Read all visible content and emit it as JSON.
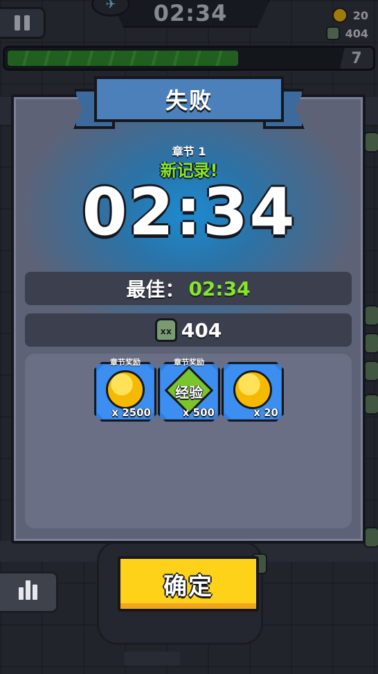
{
  "hud": {
    "timer": "02:34",
    "coins": "20",
    "kills": "404",
    "level": "7",
    "xp_progress": 0.7
  },
  "result": {
    "title": "失败",
    "chapter": "章节 1",
    "new_record": "新记录!",
    "time": "02:34",
    "best_label": "最佳：",
    "best_value": "02:34",
    "kills": "404"
  },
  "rewards": [
    {
      "tag": "章节奖励",
      "type": "coin",
      "qty": "x 2500"
    },
    {
      "tag": "章节奖励",
      "type": "exp",
      "label": "经验",
      "qty": "x 500"
    },
    {
      "tag": "",
      "type": "coin",
      "qty": "x 20"
    }
  ],
  "buttons": {
    "confirm": "确定"
  },
  "colors": {
    "accent_green": "#86e52c",
    "confirm_yellow": "#ffd21a",
    "reward_blue": "#2f7fe0",
    "panel": "#5e6276"
  }
}
